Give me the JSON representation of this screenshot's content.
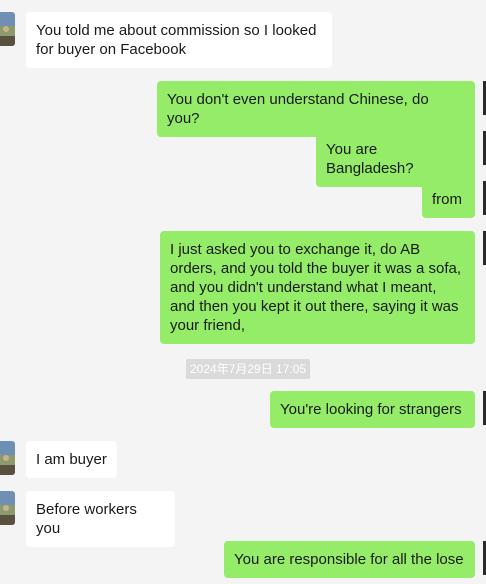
{
  "messages": [
    {
      "side": "in",
      "text": "You told me about commission so I looked for buyer on Facebook"
    },
    {
      "side": "out",
      "text": "You don't even understand Chinese, do you?"
    },
    {
      "side": "out",
      "text": "You are Bangladesh?"
    },
    {
      "side": "out",
      "text": "from"
    },
    {
      "side": "out",
      "text": "I just asked you to exchange it, do AB orders, and you told the buyer it was a sofa, and you didn't understand what I meant, and then you kept it out there, saying it was your friend,"
    },
    {
      "side": "out",
      "text": "You're looking for strangers"
    },
    {
      "side": "in",
      "text": "I am buyer"
    },
    {
      "side": "in",
      "text": "Before workers you"
    },
    {
      "side": "out",
      "text": "You are responsible for all the lose"
    }
  ],
  "timestamp": "2024年7月29日 17:05",
  "colors": {
    "background": "#f4f4f4",
    "incoming_bubble": "#ffffff",
    "outgoing_bubble": "#95ec69",
    "timestamp_bg": "#dadada"
  }
}
